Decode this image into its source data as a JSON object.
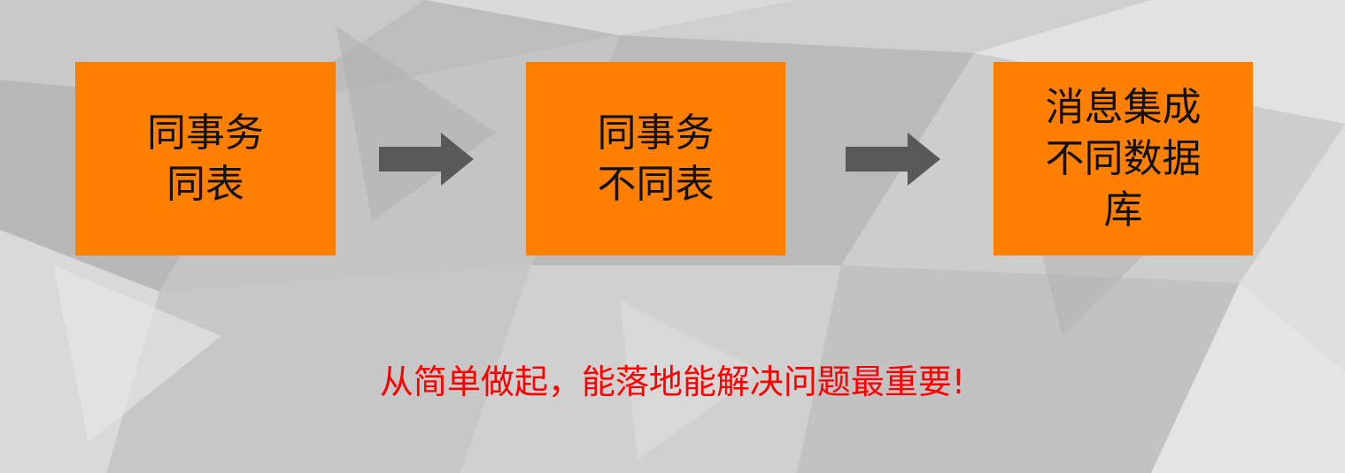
{
  "slide": {
    "boxes": [
      {
        "lines": [
          "同事务",
          "同表"
        ]
      },
      {
        "lines": [
          "同事务",
          "不同表"
        ]
      },
      {
        "lines": [
          "消息集成",
          "不同数据",
          "库"
        ]
      }
    ],
    "tagline": "从简单做起，能落地能解决问题最重要!"
  },
  "colors": {
    "box_fill": "#ff8000",
    "arrow_fill": "#595959",
    "tagline": "#ff0000"
  },
  "icons": [
    "right-arrow-icon",
    "right-arrow-icon"
  ]
}
